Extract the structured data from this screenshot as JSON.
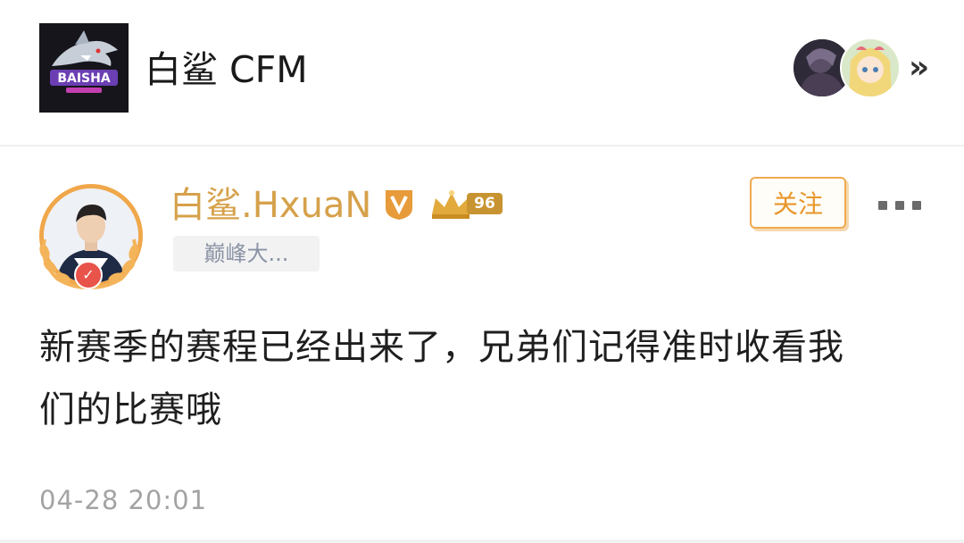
{
  "header": {
    "group_title": "白鲨 CFM",
    "logo_icon": "baisha-shark-logo",
    "member_avatars": [
      "member-avatar-1",
      "member-avatar-2"
    ],
    "more_symbol": "»"
  },
  "post": {
    "author": {
      "name": "白鲨.HxuaN",
      "verified_badge": "V",
      "level": "96",
      "tag": "巅峰大..."
    },
    "follow_label": "关注",
    "body_lines": [
      "新赛季的赛程已经出来了，兄弟们记得准时收看我",
      "们的比赛哦"
    ],
    "timestamp": "04-28 20:01"
  },
  "colors": {
    "author_gold": "#d6a14a",
    "follow_orange": "#e8962a",
    "avatar_ring": "#f0a74a",
    "badge_red": "#e8534a",
    "tag_bg": "#f2f2f2",
    "time_gray": "#a3a3a3"
  }
}
